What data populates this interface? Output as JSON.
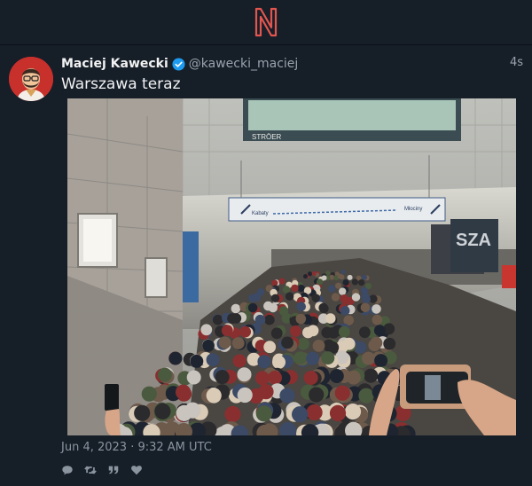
{
  "app": {
    "logo_letter": "N",
    "logo_color": "#e2564f"
  },
  "tweet": {
    "fullname": "Maciej Kawecki",
    "username": "@kawecki_maciej",
    "time_ago": "4s",
    "text": "Warszawa teraz",
    "date": "Jun 4, 2023 · 9:32 AM UTC",
    "verified": true
  },
  "media": {
    "billboard_text": "STRÖER",
    "sign_left": "Kabaty",
    "sign_right": "Młociny",
    "poster_text": "SZA"
  },
  "actions": [
    "reply-icon",
    "retweet-icon",
    "quote-icon",
    "like-icon"
  ],
  "colors": {
    "background": "#161e28",
    "accent": "#1d9bf0",
    "muted": "#8a95a0"
  }
}
